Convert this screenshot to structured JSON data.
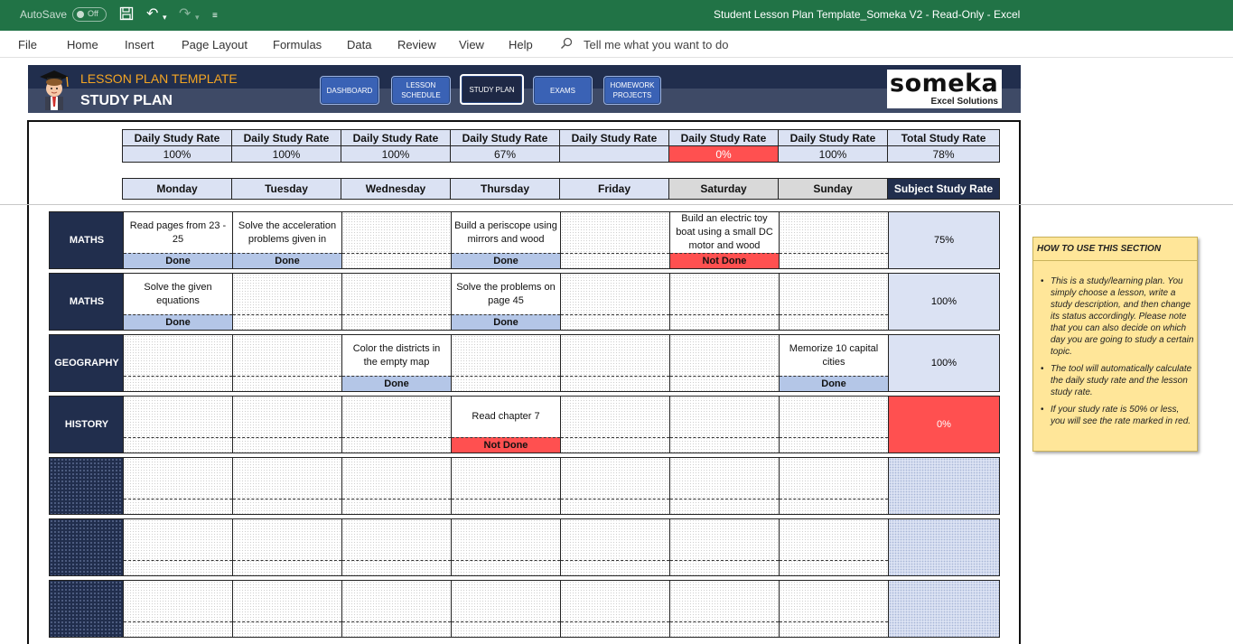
{
  "titlebar": {
    "autosave_label": "AutoSave",
    "autosave_state": "Off",
    "window_title": "Student Lesson Plan Template_Someka V2  -  Read-Only  -  Excel"
  },
  "menu": {
    "items": [
      "File",
      "Home",
      "Insert",
      "Page Layout",
      "Formulas",
      "Data",
      "Review",
      "View",
      "Help"
    ],
    "tell_me": "Tell me what you want to do"
  },
  "header": {
    "title": "LESSON PLAN TEMPLATE",
    "subtitle": "STUDY PLAN",
    "nav": [
      {
        "label": "DASHBOARD",
        "active": false
      },
      {
        "label": "LESSON SCHEDULE",
        "active": false
      },
      {
        "label": "STUDY PLAN",
        "active": true
      },
      {
        "label": "EXAMS",
        "active": false
      },
      {
        "label": "HOMEWORK PROJECTS",
        "active": false
      }
    ],
    "logo_text": "someka",
    "logo_tagline": "Excel Solutions"
  },
  "rates": {
    "headers": [
      "Daily Study Rate",
      "Daily Study Rate",
      "Daily Study Rate",
      "Daily Study Rate",
      "Daily Study Rate",
      "Daily Study Rate",
      "Daily Study Rate",
      "Total Study Rate"
    ],
    "values": [
      "100%",
      "100%",
      "100%",
      "67%",
      "",
      "0%",
      "100%",
      "78%"
    ],
    "red_index": 5
  },
  "days": [
    "Monday",
    "Tuesday",
    "Wednesday",
    "Thursday",
    "Friday",
    "Saturday",
    "Sunday",
    "Subject Study Rate"
  ],
  "lessons": [
    {
      "subject": "MATHS",
      "rate": "75%",
      "cells": [
        {
          "desc": "Read pages from 23 - 25",
          "status": "Done"
        },
        {
          "desc": "Solve the acceleration problems given in",
          "status": "Done"
        },
        {
          "desc": "",
          "status": ""
        },
        {
          "desc": "Build a periscope using mirrors and wood",
          "status": "Done"
        },
        {
          "desc": "",
          "status": ""
        },
        {
          "desc": "Build an electric toy boat using a small DC motor and wood",
          "status": "Not Done"
        },
        {
          "desc": "",
          "status": ""
        }
      ]
    },
    {
      "subject": "MATHS",
      "rate": "100%",
      "cells": [
        {
          "desc": "Solve the given equations",
          "status": "Done"
        },
        {
          "desc": "",
          "status": ""
        },
        {
          "desc": "",
          "status": ""
        },
        {
          "desc": "Solve the problems on page 45",
          "status": "Done"
        },
        {
          "desc": "",
          "status": ""
        },
        {
          "desc": "",
          "status": ""
        },
        {
          "desc": "",
          "status": ""
        }
      ]
    },
    {
      "subject": "GEOGRAPHY",
      "rate": "100%",
      "cells": [
        {
          "desc": "",
          "status": ""
        },
        {
          "desc": "",
          "status": ""
        },
        {
          "desc": "Color the districts in the empty map",
          "status": "Done"
        },
        {
          "desc": "",
          "status": ""
        },
        {
          "desc": "",
          "status": ""
        },
        {
          "desc": "",
          "status": ""
        },
        {
          "desc": "Memorize 10 capital cities",
          "status": "Done"
        }
      ]
    },
    {
      "subject": "HISTORY",
      "rate": "0%",
      "cells": [
        {
          "desc": "",
          "status": ""
        },
        {
          "desc": "",
          "status": ""
        },
        {
          "desc": "",
          "status": ""
        },
        {
          "desc": "Read chapter 7",
          "status": "Not Done"
        },
        {
          "desc": "",
          "status": ""
        },
        {
          "desc": "",
          "status": ""
        },
        {
          "desc": "",
          "status": ""
        }
      ]
    },
    {
      "subject": "",
      "rate": "",
      "cells": []
    },
    {
      "subject": "",
      "rate": "",
      "cells": []
    },
    {
      "subject": "",
      "rate": "",
      "cells": []
    }
  ],
  "help": {
    "title": "HOW TO USE THIS SECTION",
    "bullets": [
      "This is a study/learning plan. You simply choose a lesson, write a study description, and then change its status accordingly. Please note that you can also decide on which day you are going to study a certain topic.",
      "The tool will automatically calculate the daily study rate and the lesson study rate.",
      "If your study rate is 50% or less, you will see the rate marked in red."
    ]
  },
  "colors": {
    "excel_green": "#217346",
    "navy": "#212e4d",
    "light_blue": "#dbe2f3",
    "done": "#b4c6e7",
    "red": "#ff5050",
    "note_yellow": "#ffe699"
  }
}
